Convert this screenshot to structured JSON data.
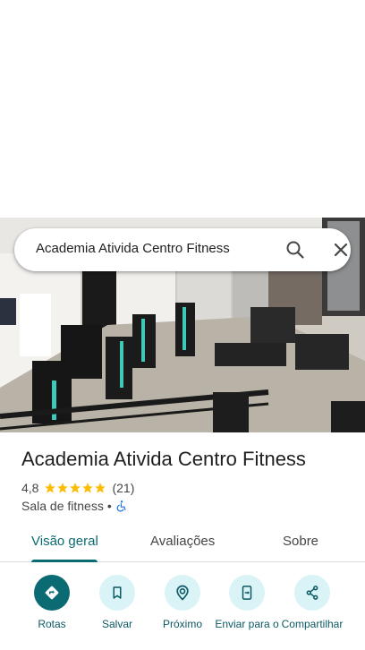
{
  "search": {
    "query": "Academia Ativida Centro Fitness"
  },
  "place": {
    "title": "Academia Ativida Centro Fitness",
    "rating": "4,8",
    "stars": 5,
    "review_count": "(21)",
    "category": "Sala de fitness",
    "separator": "•",
    "accessibility_icon": "wheelchair-icon"
  },
  "tabs": [
    {
      "label": "Visão geral",
      "active": true
    },
    {
      "label": "Avaliações",
      "active": false
    },
    {
      "label": "Sobre",
      "active": false
    }
  ],
  "actions": [
    {
      "label": "Rotas",
      "icon": "directions-icon"
    },
    {
      "label": "Salvar",
      "icon": "bookmark-icon"
    },
    {
      "label": "Próximo",
      "icon": "nearby-icon"
    },
    {
      "label": "Enviar para o",
      "icon": "send-to-phone-icon"
    },
    {
      "label": "Compartilhar",
      "icon": "share-icon"
    }
  ],
  "colors": {
    "accent": "#0b6b73",
    "action_bg": "#d9f3f7",
    "star": "#fbbc04"
  }
}
